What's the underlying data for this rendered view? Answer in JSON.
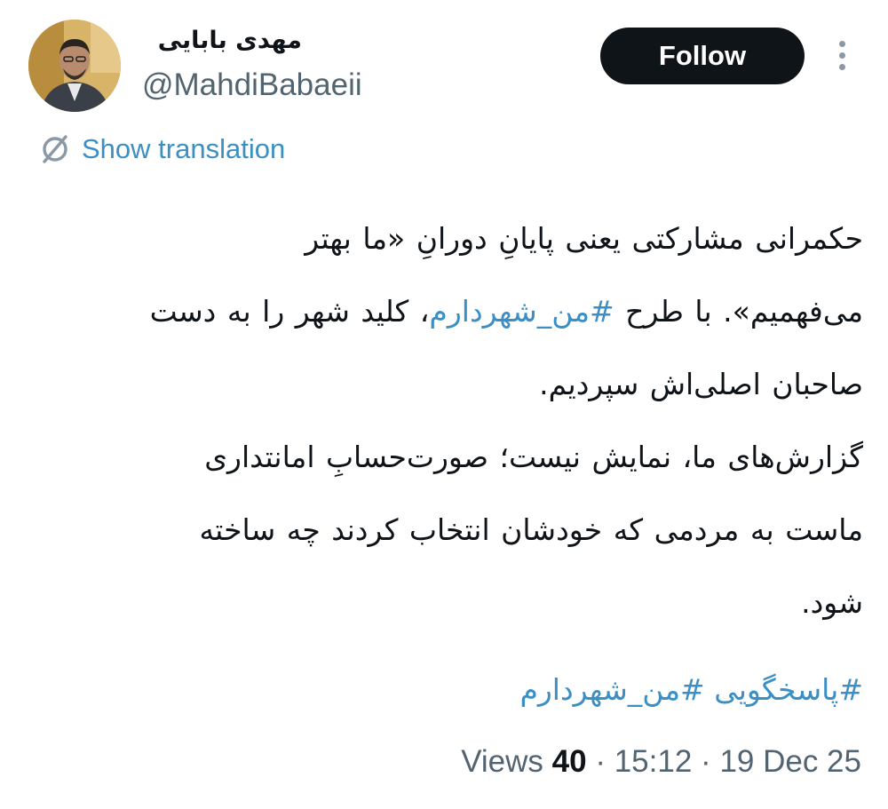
{
  "author": {
    "display_name": "مهدی بابایی",
    "handle": "@MahdiBabaeii"
  },
  "actions": {
    "follow_label": "Follow",
    "more_icon": "more-vertical-icon"
  },
  "translation": {
    "icon": "translate-icon",
    "label": "Show translation"
  },
  "tweet": {
    "line1": "حکمرانی مشارکتی یعنی پایانِ دورانِ «ما بهتر",
    "line2_a": "می‌فهمیم». با طرح",
    "line2_tag": "#من_شهردارم",
    "line2_b": "، کلید شهر را به دست",
    "line3": "صاحبان اصلی‌اش سپردیم.",
    "line4": "گزارش‌های ما، نمایش نیست؛ صورت‌حسابِ امانتداری",
    "line5": "ماست به مردمی که خودشان انتخاب کردند چه ساخته",
    "line6": "شود.",
    "hashtags": [
      "#پاسخگویی",
      "#من_شهردارم"
    ]
  },
  "meta": {
    "views_label": "Views",
    "views_count": "40",
    "separator": "·",
    "time": "15:12",
    "date": "19 Dec 25"
  },
  "colors": {
    "link": "#3b8fc4",
    "text": "#0f1419",
    "muted": "#536471",
    "button_bg": "#0f1419"
  }
}
